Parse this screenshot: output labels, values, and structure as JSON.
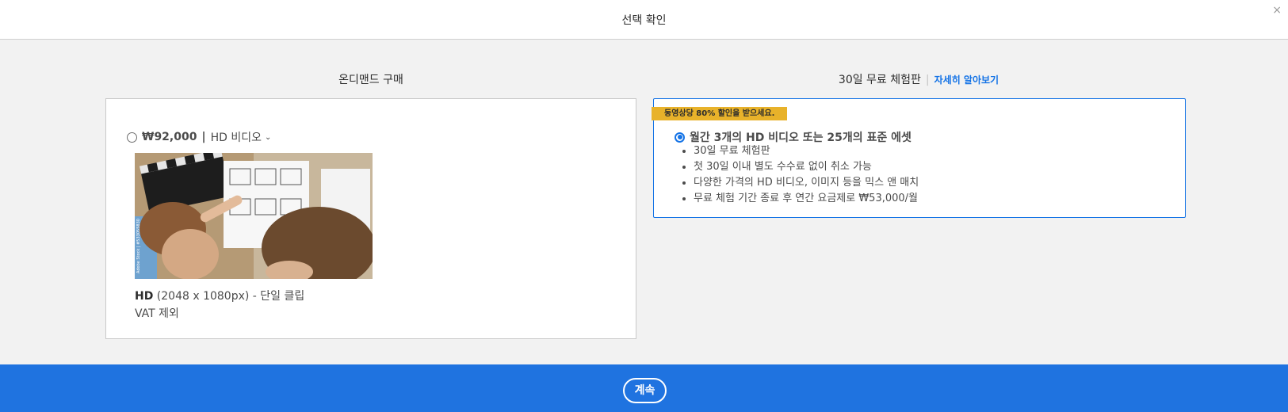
{
  "header": {
    "title": "선택 확인",
    "close_glyph": "×"
  },
  "left_column": {
    "heading": "온디맨드 구매",
    "price": "₩92,000",
    "separator": "|",
    "license_label": "HD 비디오",
    "chevron_glyph": "⌄",
    "resolution_label": "HD",
    "resolution_detail": "(2048 x 1080px) - 단일 클립",
    "vat_note": "VAT 제외",
    "thumbnail_watermark": "Adobe Stock | #533055830"
  },
  "right_column": {
    "heading": "30일 무료 체험판",
    "separator": "|",
    "learn_more": "자세히 알아보기",
    "promo_badge": "동영상당 80% 할인을 받으세요.",
    "plan_title": "월간 3개의 HD 비디오 또는 25개의 표준 에셋",
    "features": [
      "30일 무료 체험판",
      "첫 30일 이내 별도 수수료 없이 취소 가능",
      "다양한 가격의 HD 비디오, 이미지 등을 믹스 앤 매치",
      "무료 체험 기간 종료 후 연간 요금제로 ₩53,000/월"
    ]
  },
  "footer": {
    "continue_label": "계속"
  },
  "colors": {
    "accent": "#1473e6",
    "footer_bg": "#1f73e0",
    "badge": "#e8b22a"
  },
  "icons": [
    "close-icon",
    "chevron-down-icon",
    "radio-icon"
  ]
}
